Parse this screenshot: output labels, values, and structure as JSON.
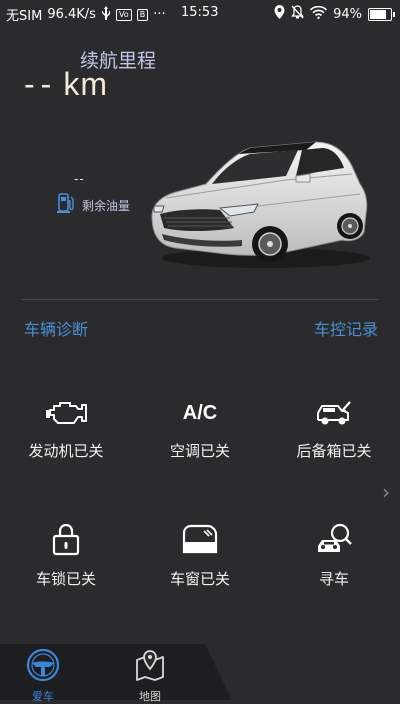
{
  "status_bar": {
    "carrier": "无SIM",
    "speed": "96.4K/s",
    "usb_icon": "usb-icon",
    "badge1": "Vo",
    "badge2": "B",
    "dots": "···",
    "time": "15:53",
    "battery_percent": "94%",
    "battery_level": 0.94
  },
  "range": {
    "label": "续航里程",
    "value": "--",
    "unit": "km"
  },
  "fuel": {
    "value": "--",
    "label": "剩余油量"
  },
  "links": {
    "diagnosis": "车辆诊断",
    "records": "车控记录"
  },
  "controls": [
    {
      "label": "发动机已关",
      "icon": "engine-icon"
    },
    {
      "label": "空调已关",
      "icon_text": "A/C"
    },
    {
      "label": "后备箱已关",
      "icon": "trunk-icon"
    },
    {
      "label": "车锁已关",
      "icon": "lock-icon"
    },
    {
      "label": "车窗已关",
      "icon": "window-icon"
    },
    {
      "label": "寻车",
      "icon": "find-car-icon"
    }
  ],
  "nav": [
    {
      "label": "爱车",
      "icon": "steering-wheel-icon",
      "active": true
    },
    {
      "label": "地图",
      "icon": "map-pin-icon",
      "active": false
    }
  ],
  "colors": {
    "background": "#2b2b2d",
    "accent_blue": "#4a8fd6",
    "range_label": "#c3c6e6",
    "range_value": "#f3e9d6"
  }
}
